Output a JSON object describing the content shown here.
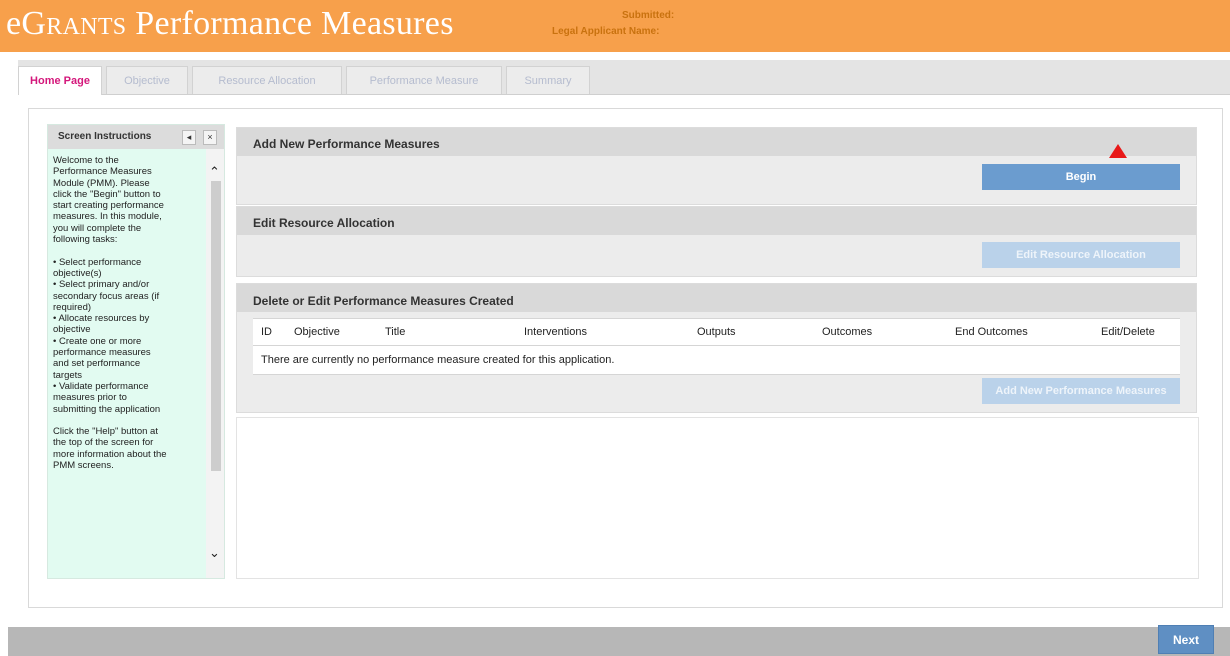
{
  "header": {
    "title_prefix": "e",
    "title_grants": "Grants",
    "title_rest": " Performance Measures",
    "submitted_label": "Submitted:",
    "applicant_label": "Legal Applicant Name:",
    "applicant_name": "",
    "colors": {
      "header_bg": "#f7a04b",
      "active_tab": "#d4177b",
      "button_primary": "#6b9ccf"
    }
  },
  "tabs": [
    {
      "label": "Home Page",
      "active": true
    },
    {
      "label": "Objective",
      "active": false
    },
    {
      "label": "Resource Allocation",
      "active": false
    },
    {
      "label": "Performance Measure",
      "active": false
    },
    {
      "label": "Summary",
      "active": false
    }
  ],
  "instructions": {
    "title": "Screen Instructions",
    "collapse_symbol": "◂",
    "close_symbol": "×",
    "text": "Welcome to the\nPerformance Measures\nModule (PMM). Please\nclick the \"Begin\" button to\nstart creating performance\nmeasures. In this module,\nyou will complete the\nfollowing tasks:\n\n• Select performance\nobjective(s)\n• Select primary and/or\nsecondary focus areas (if\nrequired)\n• Allocate resources by\nobjective\n• Create one or more\nperformance measures\nand set performance\ntargets\n• Validate performance\nmeasures prior to\nsubmitting the application\n\nClick the \"Help\" button at\nthe top of the screen for\nmore information about the\nPMM screens."
  },
  "sections": {
    "add": {
      "title": "Add New Performance Measures",
      "button": "Begin"
    },
    "edit_resource": {
      "title": "Edit Resource Allocation",
      "button": "Edit Resource Allocation"
    },
    "delete_edit": {
      "title": "Delete or Edit Performance Measures Created",
      "columns": [
        "ID",
        "Objective",
        "Title",
        "Interventions",
        "Outputs",
        "Outcomes",
        "End Outcomes",
        "Edit/Delete"
      ],
      "empty_message": "There are currently no performance measure created for this application.",
      "button": "Add New Performance Measures"
    }
  },
  "footer": {
    "next_label": "Next"
  }
}
